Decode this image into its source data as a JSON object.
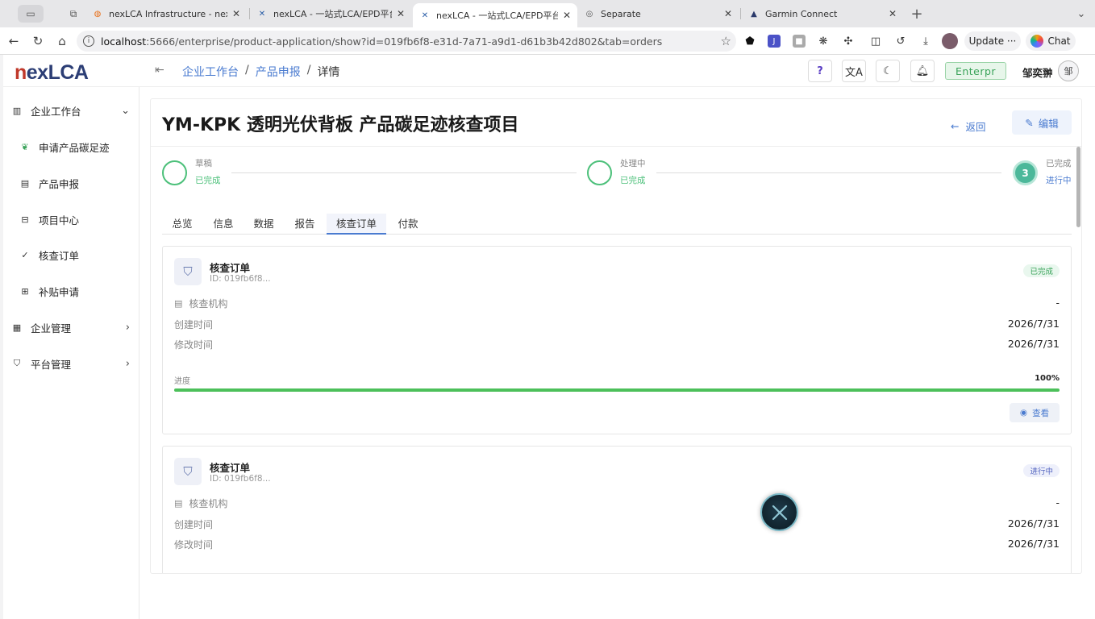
{
  "browser": {
    "tabs": [
      {
        "title": "nexLCA Infrastructure - nexLCA",
        "icon": "gitea-icon"
      },
      {
        "title": "nexLCA - 一站式LCA/EPD平台",
        "icon": "nexlca-icon"
      },
      {
        "title": "nexLCA - 一站式LCA/EPD平台",
        "icon": "nexlca-icon",
        "active": true
      },
      {
        "title": "Separate",
        "icon": "globe-icon"
      },
      {
        "title": "Garmin Connect",
        "icon": "garmin-icon"
      }
    ],
    "url_host": "localhost",
    "url_rest": ":5666/enterprise/product-application/show?id=019fb6f8-e31d-7a71-a9d1-d61b3b42d802&tab=orders",
    "update_label": "Update",
    "chat_label": "Chat"
  },
  "app": {
    "logo": {
      "n": "n",
      "rest": "exLCA"
    },
    "breadcrumb": [
      "企业工作台",
      "产品申报",
      "详情"
    ],
    "help_label": "?",
    "plan_label": "Enterpr",
    "user_name": "邹奕翀",
    "avatar_text": "邹"
  },
  "sidebar": {
    "items": [
      {
        "label": "企业工作台",
        "icon": "building-icon",
        "arrow": "⌄"
      },
      {
        "label": "申请产品碳足迹",
        "icon": "leaf-icon"
      },
      {
        "label": "产品申报",
        "icon": "clipboard-icon"
      },
      {
        "label": "项目中心",
        "icon": "briefcase-icon"
      },
      {
        "label": "核查订单",
        "icon": "check-icon"
      },
      {
        "label": "补贴申请",
        "icon": "receipt-icon"
      },
      {
        "label": "企业管理",
        "icon": "office-icon",
        "arrow": "›"
      },
      {
        "label": "平台管理",
        "icon": "shield-icon",
        "arrow": "›"
      }
    ]
  },
  "page": {
    "title": "YM-KPK 透明光伏背板 产品碳足迹核查项目",
    "back_label": "返回",
    "edit_label": "编辑",
    "steps": [
      {
        "label": "草稿",
        "status": "已完成"
      },
      {
        "label": "处理中",
        "status": "已完成"
      },
      {
        "label": "已完成",
        "status": "进行中",
        "number": "3"
      }
    ],
    "tabs": [
      "总览",
      "信息",
      "数据",
      "报告",
      "核查订单",
      "付款"
    ],
    "orders": [
      {
        "title": "核查订单",
        "id": "ID: 019fb6f8...",
        "badge": "已完成",
        "agency_label": "核查机构",
        "agency_value": "-",
        "created_label": "创建时间",
        "created_value": "2026/7/31",
        "modified_label": "修改时间",
        "modified_value": "2026/7/31",
        "progress_label": "进度",
        "progress_value": "100%",
        "progress": 1.0,
        "view_label": "查看"
      },
      {
        "title": "核查订单",
        "id": "ID: 019fb6f8...",
        "badge": "进行中",
        "agency_label": "核查机构",
        "agency_value": "-",
        "created_label": "创建时间",
        "created_value": "2026/7/31",
        "modified_label": "修改时间",
        "modified_value": "2026/7/31"
      }
    ]
  },
  "colors": {
    "accent": "#4a7bd0",
    "success": "#4cc07a",
    "progress": "#4cc05a"
  }
}
